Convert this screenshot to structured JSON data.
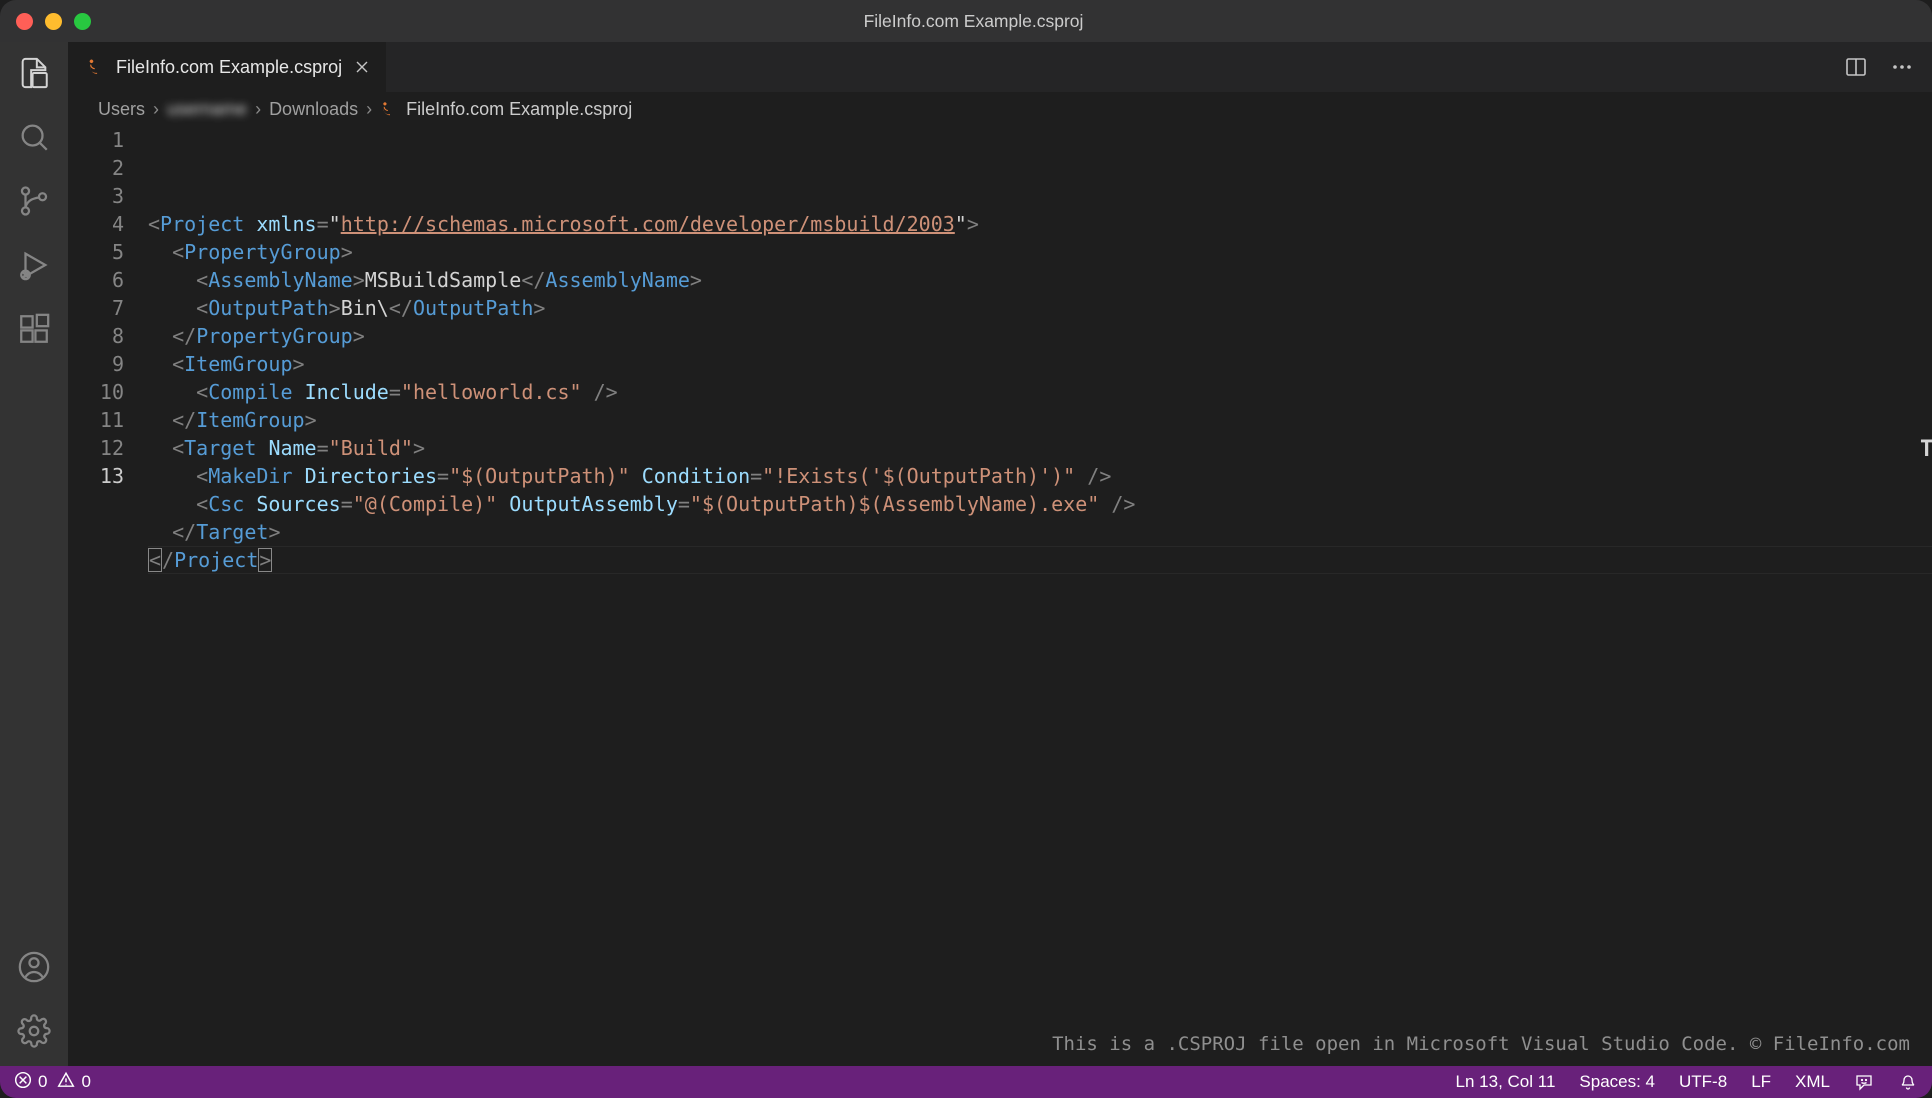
{
  "window": {
    "title": "FileInfo.com Example.csproj"
  },
  "tab": {
    "label": "FileInfo.com Example.csproj"
  },
  "breadcrumbs": {
    "seg0": "Users",
    "seg1": "username",
    "seg2": "Downloads",
    "seg3": "FileInfo.com Example.csproj"
  },
  "editor": {
    "line_numbers": [
      "1",
      "2",
      "3",
      "4",
      "5",
      "6",
      "7",
      "8",
      "9",
      "10",
      "11",
      "12",
      "13"
    ],
    "active_line_index": 12,
    "code_tokens": [
      [
        {
          "p": "<"
        },
        {
          "tg": "Project"
        },
        {
          "tx": " "
        },
        {
          "at": "xmlns"
        },
        {
          "p": "="
        },
        {
          "tx": "\""
        },
        {
          "stul": "http://schemas.microsoft.com/developer/msbuild/2003"
        },
        {
          "tx": "\""
        },
        {
          "p": ">"
        }
      ],
      [
        {
          "tx": "  "
        },
        {
          "p": "<"
        },
        {
          "tg": "PropertyGroup"
        },
        {
          "p": ">"
        }
      ],
      [
        {
          "tx": "    "
        },
        {
          "p": "<"
        },
        {
          "tg": "AssemblyName"
        },
        {
          "p": ">"
        },
        {
          "tx": "MSBuildSample"
        },
        {
          "p": "</"
        },
        {
          "tg": "AssemblyName"
        },
        {
          "p": ">"
        }
      ],
      [
        {
          "tx": "    "
        },
        {
          "p": "<"
        },
        {
          "tg": "OutputPath"
        },
        {
          "p": ">"
        },
        {
          "tx": "Bin\\"
        },
        {
          "p": "</"
        },
        {
          "tg": "OutputPath"
        },
        {
          "p": ">"
        }
      ],
      [
        {
          "tx": "  "
        },
        {
          "p": "</"
        },
        {
          "tg": "PropertyGroup"
        },
        {
          "p": ">"
        }
      ],
      [
        {
          "tx": "  "
        },
        {
          "p": "<"
        },
        {
          "tg": "ItemGroup"
        },
        {
          "p": ">"
        }
      ],
      [
        {
          "tx": "    "
        },
        {
          "p": "<"
        },
        {
          "tg": "Compile"
        },
        {
          "tx": " "
        },
        {
          "at": "Include"
        },
        {
          "p": "="
        },
        {
          "st": "\"helloworld.cs\""
        },
        {
          "tx": " "
        },
        {
          "p": "/>"
        }
      ],
      [
        {
          "tx": "  "
        },
        {
          "p": "</"
        },
        {
          "tg": "ItemGroup"
        },
        {
          "p": ">"
        }
      ],
      [
        {
          "tx": "  "
        },
        {
          "p": "<"
        },
        {
          "tg": "Target"
        },
        {
          "tx": " "
        },
        {
          "at": "Name"
        },
        {
          "p": "="
        },
        {
          "st": "\"Build\""
        },
        {
          "p": ">"
        }
      ],
      [
        {
          "tx": "    "
        },
        {
          "p": "<"
        },
        {
          "tg": "MakeDir"
        },
        {
          "tx": " "
        },
        {
          "at": "Directories"
        },
        {
          "p": "="
        },
        {
          "st": "\"$(OutputPath)\""
        },
        {
          "tx": " "
        },
        {
          "at": "Condition"
        },
        {
          "p": "="
        },
        {
          "st": "\"!Exists('$(OutputPath)')\""
        },
        {
          "tx": " "
        },
        {
          "p": "/>"
        }
      ],
      [
        {
          "tx": "    "
        },
        {
          "p": "<"
        },
        {
          "tg": "Csc"
        },
        {
          "tx": " "
        },
        {
          "at": "Sources"
        },
        {
          "p": "="
        },
        {
          "st": "\"@(Compile)\""
        },
        {
          "tx": " "
        },
        {
          "at": "OutputAssembly"
        },
        {
          "p": "="
        },
        {
          "st": "\"$(OutputPath)$(AssemblyName).exe\""
        },
        {
          "tx": " "
        },
        {
          "p": "/>"
        }
      ],
      [
        {
          "tx": "  "
        },
        {
          "p": "</"
        },
        {
          "tg": "Target"
        },
        {
          "p": ">"
        }
      ],
      [
        {
          "bb": "<"
        },
        {
          "p": "/"
        },
        {
          "tg": "Project"
        },
        {
          "bb": ">"
        }
      ]
    ],
    "caption": "This is a .CSPROJ file open in Microsoft Visual Studio Code. © FileInfo.com"
  },
  "status": {
    "errors": "0",
    "warnings": "0",
    "cursor": "Ln 13, Col 11",
    "spaces": "Spaces: 4",
    "encoding": "UTF-8",
    "eol": "LF",
    "language": "XML"
  }
}
